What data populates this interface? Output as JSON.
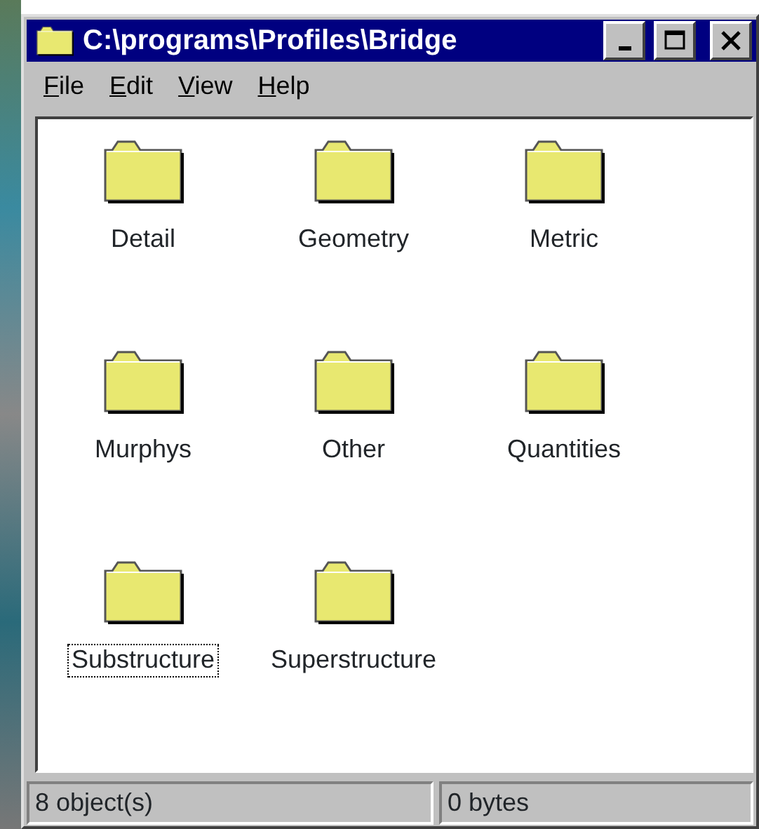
{
  "window": {
    "title": "C:\\programs\\Profiles\\Bridge",
    "controls": [
      {
        "kind": "minimize"
      },
      {
        "kind": "maximize"
      },
      {
        "kind": "close"
      }
    ]
  },
  "menu": [
    {
      "mnemonic": "F",
      "rest": "ile"
    },
    {
      "mnemonic": "E",
      "rest": "dit"
    },
    {
      "mnemonic": "V",
      "rest": "iew"
    },
    {
      "mnemonic": "H",
      "rest": "elp"
    }
  ],
  "folders": [
    {
      "name": "Detail",
      "focused": false
    },
    {
      "name": "Geometry",
      "focused": false
    },
    {
      "name": "Metric",
      "focused": false
    },
    {
      "name": "Murphys",
      "focused": false
    },
    {
      "name": "Other",
      "focused": false
    },
    {
      "name": "Quantities",
      "focused": false
    },
    {
      "name": "Substructure",
      "focused": true
    },
    {
      "name": "Superstructure",
      "focused": false
    }
  ],
  "status_bar": [
    "8 object(s)",
    "0 bytes"
  ]
}
